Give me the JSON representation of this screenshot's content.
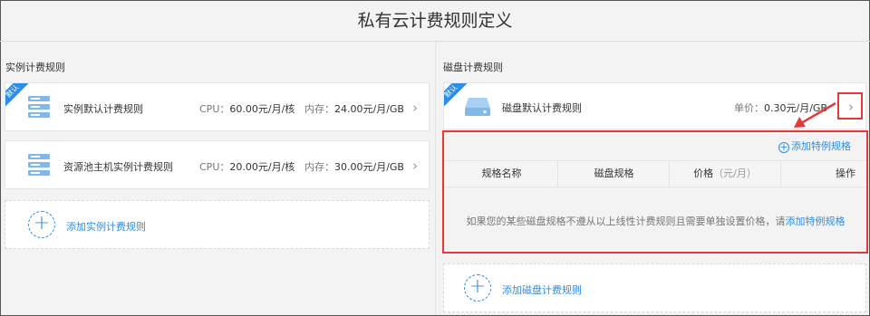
{
  "page": {
    "title": "私有云计费规则定义"
  },
  "instance": {
    "section_label": "实例计费规则",
    "cards": [
      {
        "badge": "默认",
        "name": "实例默认计费规则",
        "cpu_label": "CPU：",
        "cpu_value": "60.00元/月/核",
        "mem_label": "内存：",
        "mem_value": "24.00元/月/GB"
      },
      {
        "name": "资源池主机实例计费规则",
        "cpu_label": "CPU：",
        "cpu_value": "20.00元/月/核",
        "mem_label": "内存：",
        "mem_value": "30.00元/月/GB"
      }
    ],
    "add_label": "添加实例计费规则"
  },
  "disk": {
    "section_label": "磁盘计费规则",
    "card": {
      "badge": "默认",
      "name": "磁盘默认计费规则",
      "price_label": "单价：",
      "price_value": "0.30元/月/GB"
    },
    "add_special_label": "添加特例规格",
    "table": {
      "columns": [
        "规格名称",
        "磁盘规格",
        "价格",
        "（元/月）",
        "操作"
      ]
    },
    "empty_text": "如果您的某些磁盘规格不遵从以上线性计费规则且需要单独设置价格，请",
    "empty_link": "添加特例规格",
    "add_label": "添加磁盘计费规则"
  },
  "icons": [
    "stack-icon",
    "disk-icon",
    "chevron-right-icon",
    "plus-icon",
    "arrow-icon"
  ],
  "colors": {
    "accent": "#2d8ce3",
    "highlight": "#e23a3a"
  }
}
